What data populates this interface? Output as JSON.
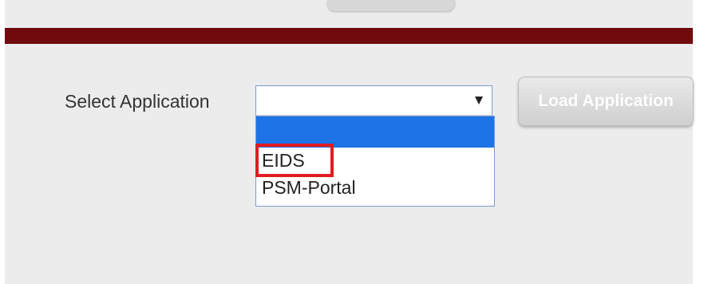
{
  "form": {
    "select_label": "Select Application",
    "selected_value": "",
    "options": [
      "",
      "EIDS",
      "PSM-Portal"
    ],
    "highlighted_option": "EIDS",
    "load_button_label": "Load Application",
    "load_button_enabled": false
  },
  "colors": {
    "banner": "#710a0c",
    "panel_background": "#ececec",
    "selected_option": "#1e73e6",
    "highlight_box": "#e11b22"
  }
}
